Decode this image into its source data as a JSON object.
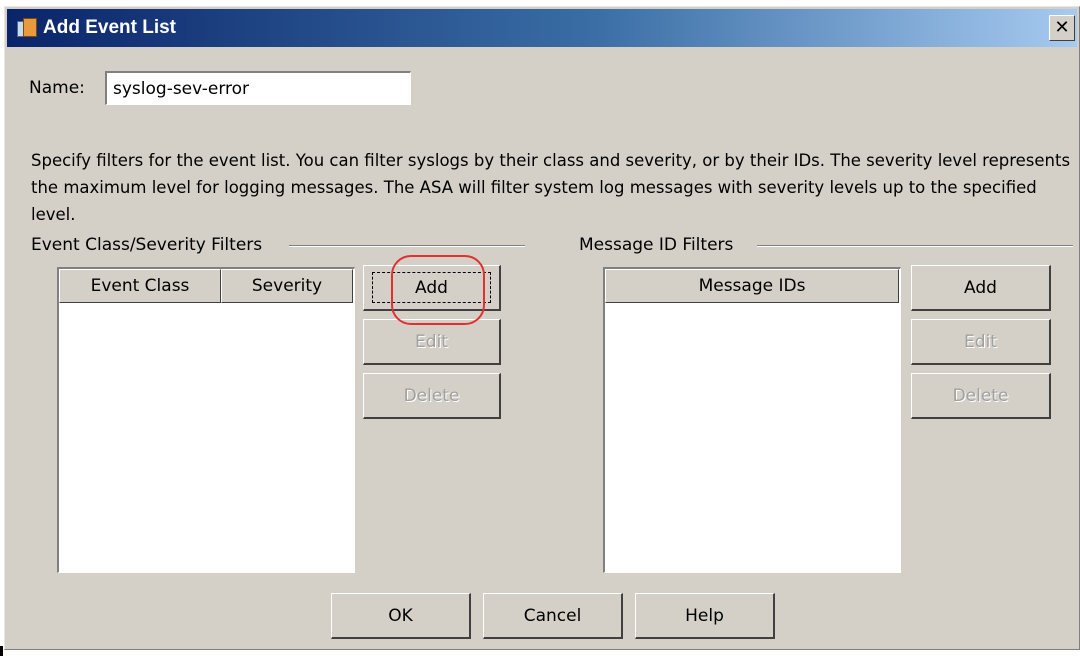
{
  "window": {
    "title": "Add Event List",
    "close_glyph": "✕"
  },
  "name_field": {
    "label": "Name:",
    "value": "syslog-sev-error"
  },
  "description": "Specify filters for the event list. You can filter syslogs by their class and severity, or by their IDs. The severity level represents the maximum level for logging messages. The ASA will filter system log messages with severity levels up to the specified level.",
  "event_class_group": {
    "title": "Event Class/Severity Filters",
    "columns": [
      "Event Class",
      "Severity"
    ],
    "buttons": {
      "add": "Add",
      "edit": "Edit",
      "delete": "Delete"
    }
  },
  "message_id_group": {
    "title": "Message ID Filters",
    "columns": [
      "Message IDs"
    ],
    "buttons": {
      "add": "Add",
      "edit": "Edit",
      "delete": "Delete"
    }
  },
  "footer": {
    "ok": "OK",
    "cancel": "Cancel",
    "help": "Help"
  },
  "colors": {
    "dialog_bg": "#d4d0c8",
    "titlebar_start": "#0a246a",
    "titlebar_end": "#a6caf0",
    "highlight": "#e03030"
  },
  "icons": {
    "title": "event-list-app-icon",
    "close": "close-icon"
  }
}
